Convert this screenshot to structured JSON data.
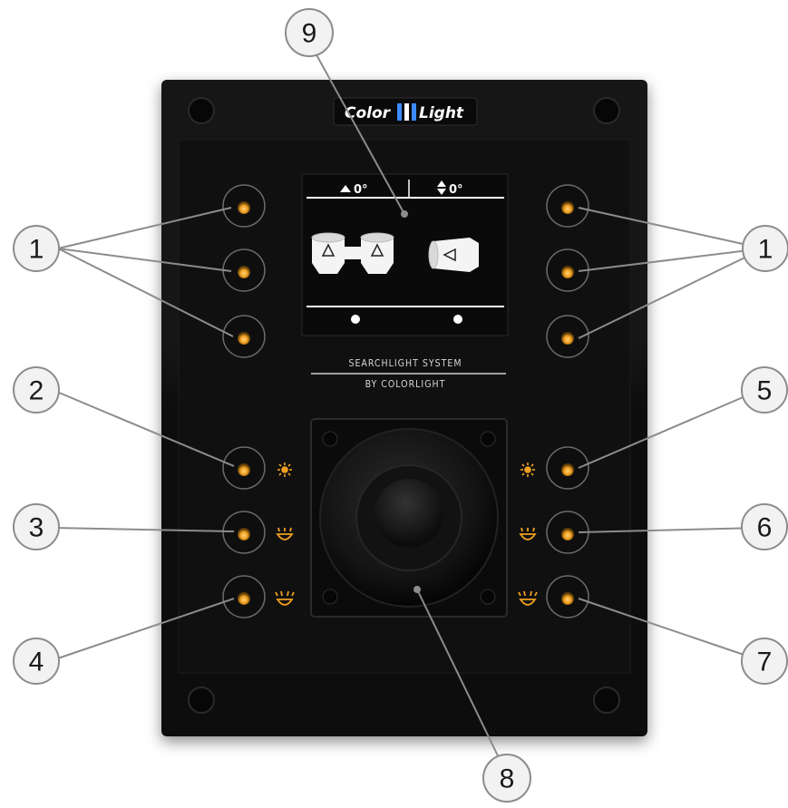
{
  "brand": {
    "logo_left": "Color",
    "logo_right": "Light"
  },
  "display": {
    "tilt_readout": "0°",
    "pan_readout": "0°"
  },
  "caption": {
    "line1": "SEARCHLIGHT SYSTEM",
    "line2": "BY COLORLIGHT"
  },
  "callouts": {
    "c1_left": "1",
    "c1_right": "1",
    "c2": "2",
    "c3": "3",
    "c4": "4",
    "c5": "5",
    "c6": "6",
    "c7": "7",
    "c8": "8",
    "c9": "9"
  },
  "icons": {
    "brightness": "sun-icon",
    "low_beam": "low-beam-icon",
    "high_beam": "high-beam-icon"
  },
  "colors": {
    "panel": "#121212",
    "led": "#f0a020",
    "callout_fill": "#f2f2f2",
    "callout_line": "#8c8c8c",
    "screen_bg": "#0a0a0a",
    "lamp_fill": "#f4f4f4"
  }
}
